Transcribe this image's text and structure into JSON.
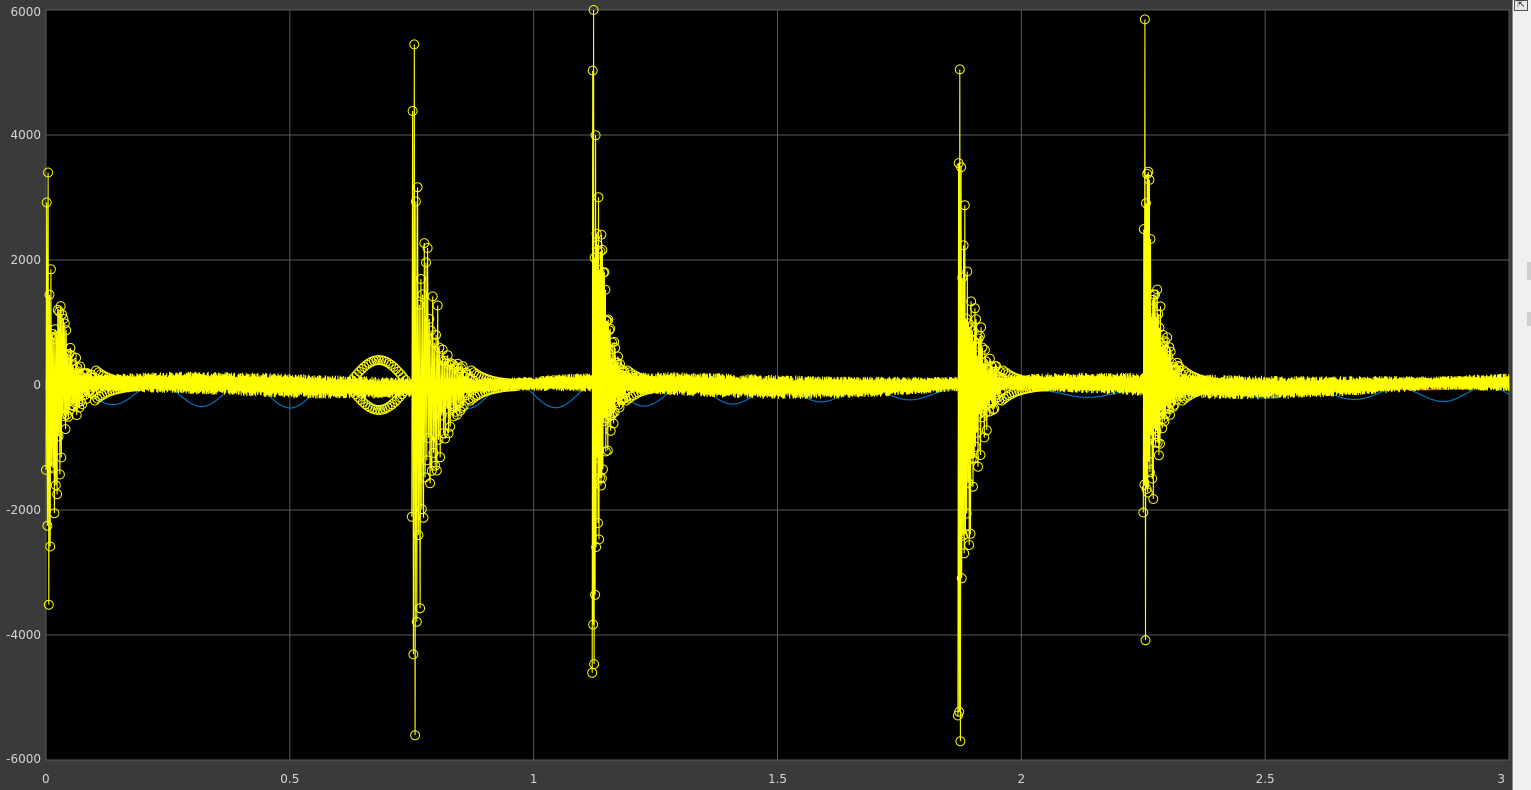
{
  "chart_data": {
    "type": "line",
    "title": "",
    "xlabel": "",
    "ylabel": "",
    "xlim": [
      0,
      3
    ],
    "ylim": [
      -6000,
      6000
    ],
    "x_ticks": [
      0,
      0.5,
      1,
      1.5,
      2,
      2.5,
      3
    ],
    "x_tick_labels": [
      "0",
      "0.5",
      "1",
      "1.5",
      "2",
      "2.5",
      "3"
    ],
    "y_ticks": [
      -6000,
      -4000,
      -2000,
      0,
      2000,
      4000,
      6000
    ],
    "y_tick_labels": [
      "-6000",
      "-4000",
      "-2000",
      "0",
      "2000",
      "4000",
      "6000"
    ],
    "grid": true,
    "background": "#000000",
    "series": [
      {
        "color": "#ffff00",
        "marker": "circle",
        "bursts": [
          {
            "t": 0.0,
            "peak": 3400,
            "trough": -3700,
            "dur": 0.1
          },
          {
            "t": 0.75,
            "peak": 5450,
            "trough": -5900,
            "dur": 0.12
          },
          {
            "t": 1.12,
            "peak": 6000,
            "trough": -4700,
            "dur": 0.07
          },
          {
            "t": 1.87,
            "peak": 5050,
            "trough": -6000,
            "dur": 0.09
          },
          {
            "t": 2.25,
            "peak": 5850,
            "trough": -4300,
            "dur": 0.08
          }
        ],
        "baseline_band": 150
      },
      {
        "color": "#d95319",
        "amplitude": 120
      },
      {
        "color": "#0072bd",
        "amplitude": 230,
        "offset": -150
      }
    ]
  },
  "ui": {
    "restore_icon": "restore-icon",
    "restore_glyph": "⇱"
  }
}
